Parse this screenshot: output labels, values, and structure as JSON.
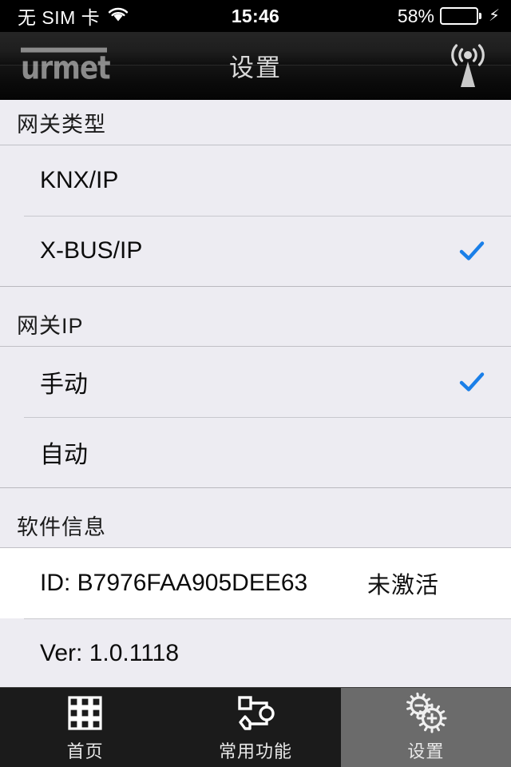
{
  "statusbar": {
    "carrier": "无 SIM 卡",
    "wifi_icon": "wifi-icon",
    "time": "15:46",
    "battery_percent": "58%",
    "battery_level": 58,
    "charging_icon": "lightning-bolt-icon",
    "battery_color": "#4cd04c"
  },
  "navbar": {
    "logo_text": "urmet",
    "title": "设置",
    "antenna_icon": "antenna-broadcast-icon"
  },
  "colors": {
    "accent_check": "#1a7fe8",
    "list_background": "#edecf2",
    "row_highlight": "#ffffff",
    "tab_active": "#6b6b6b",
    "navbar": "#111111"
  },
  "sections": [
    {
      "header": "网关类型",
      "rows": [
        {
          "label": "KNX/IP",
          "checked": false,
          "value": "",
          "white": false
        },
        {
          "label": "X-BUS/IP",
          "checked": true,
          "value": "",
          "white": false
        }
      ]
    },
    {
      "header": "网关IP",
      "rows": [
        {
          "label": "手动",
          "checked": true,
          "value": "",
          "white": false
        },
        {
          "label": "自动",
          "checked": false,
          "value": "",
          "white": false
        }
      ]
    },
    {
      "header": "软件信息",
      "rows": [
        {
          "label": "ID:  B7976FAA905DEE63",
          "checked": false,
          "value": "未激活",
          "white": true
        },
        {
          "label": "Ver: 1.0.1118",
          "checked": false,
          "value": "",
          "white": false
        }
      ]
    }
  ],
  "tabbar": {
    "tabs": [
      {
        "label": "首页",
        "icon": "grid-icon",
        "active": false
      },
      {
        "label": "常用功能",
        "icon": "flowchart-icon",
        "active": false
      },
      {
        "label": "设置",
        "icon": "gears-icon",
        "active": true
      }
    ]
  }
}
